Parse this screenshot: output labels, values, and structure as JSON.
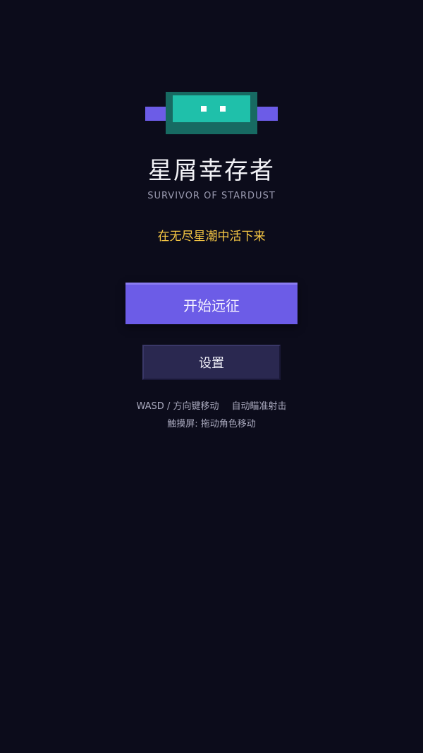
{
  "game": {
    "title": "星屑幸存者",
    "subtitle": "SURVIVOR OF STARDUST",
    "tagline": "在无尽星潮中活下来"
  },
  "menu": {
    "start_label": "开始远征",
    "settings_label": "设置"
  },
  "controls": {
    "keyboard_move": "WASD / 方向键移动",
    "auto_fire": "自动瞄准射击",
    "touch": "触摸屏: 拖动角色移动"
  },
  "colors": {
    "background": "#0c0c1b",
    "accent": "#6c5ce7",
    "logo_teal": "#1fc0aa",
    "logo_dark_teal": "#176a62",
    "tagline": "#f6c744",
    "settings_button": "#2a2850"
  },
  "icons": {
    "logo": "pixel-robot-icon"
  }
}
